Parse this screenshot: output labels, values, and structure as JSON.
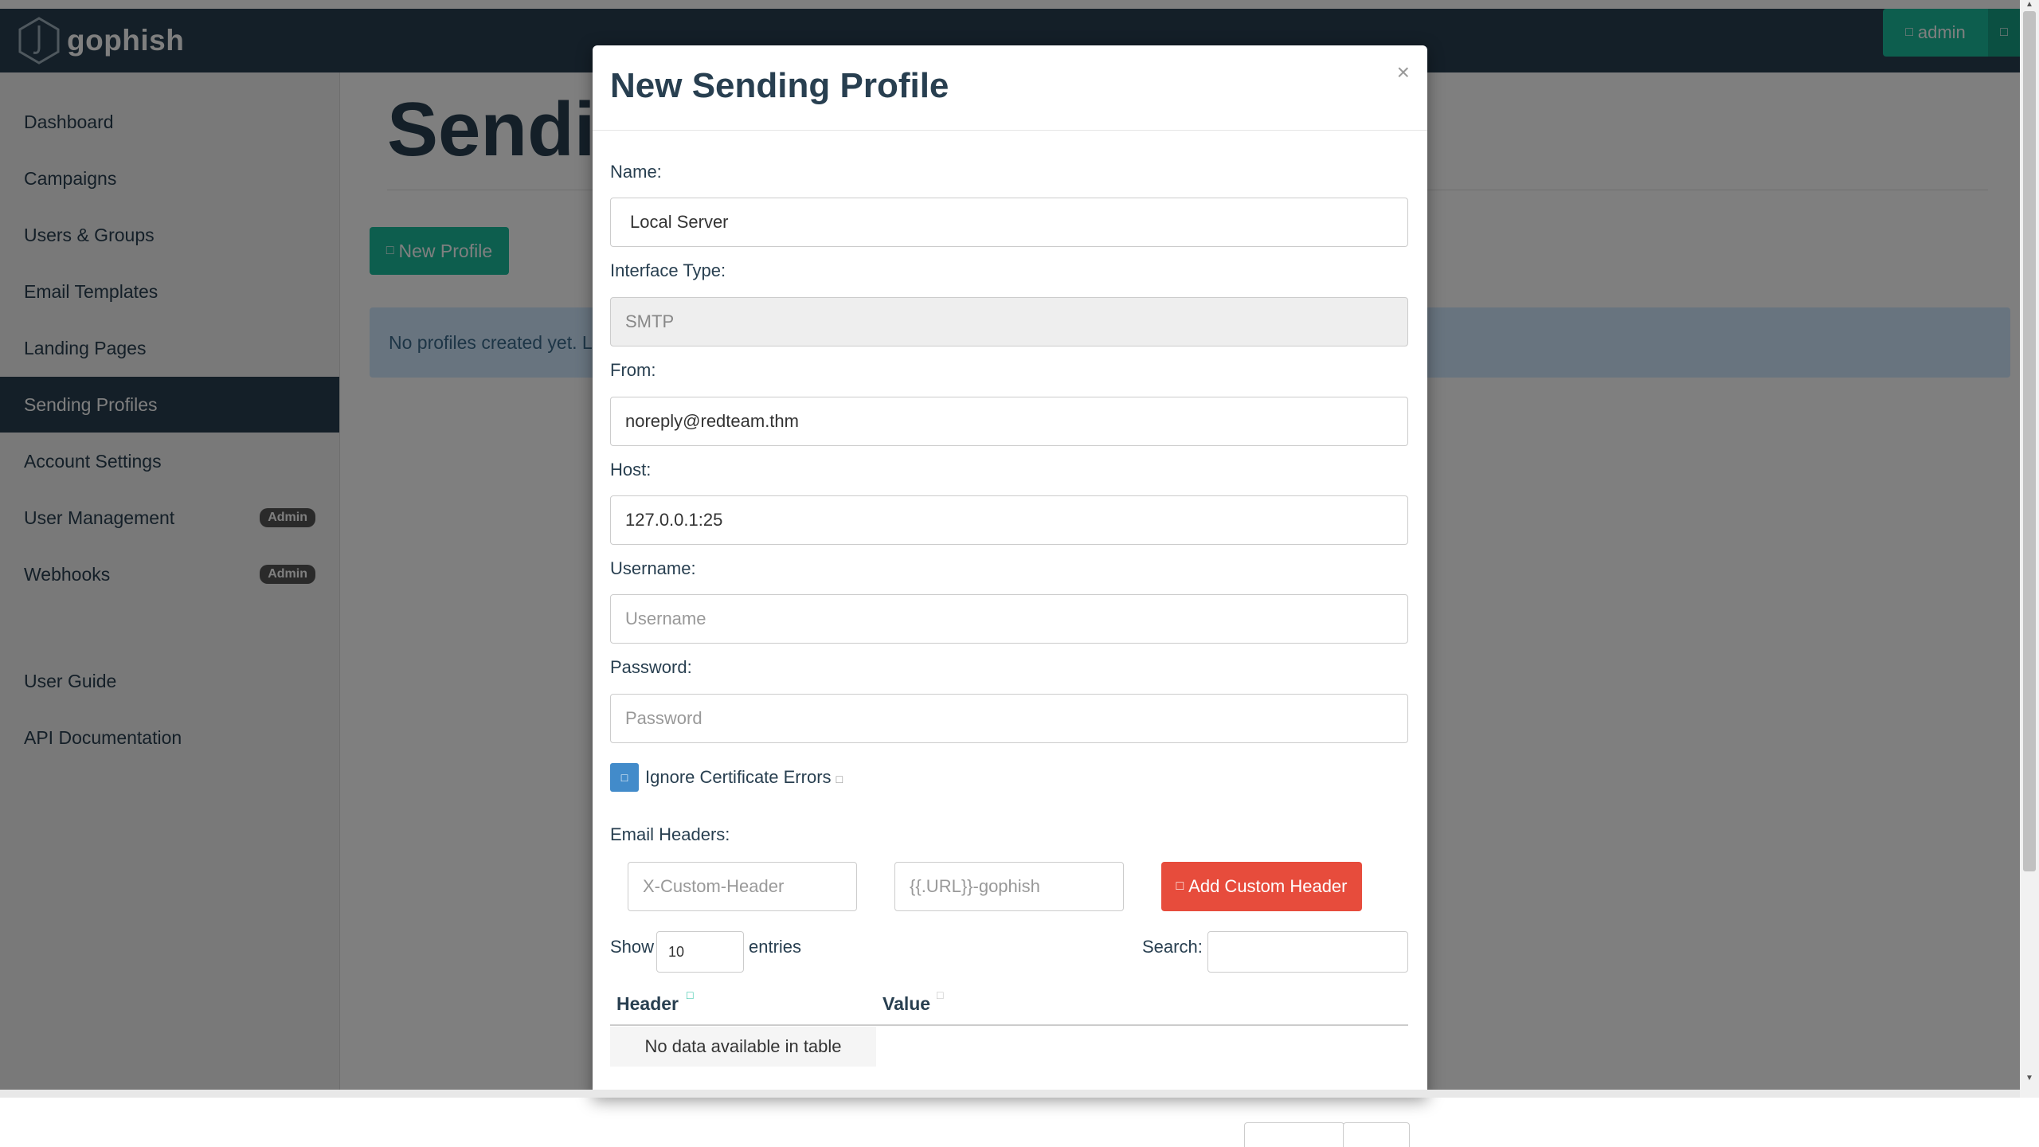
{
  "navbar": {
    "brand": "gophish",
    "admin_label": "admin",
    "dropdown_icon": "caret-icon"
  },
  "sidebar": {
    "items": [
      {
        "label": "Dashboard"
      },
      {
        "label": "Campaigns"
      },
      {
        "label": "Users & Groups"
      },
      {
        "label": "Email Templates"
      },
      {
        "label": "Landing Pages"
      },
      {
        "label": "Sending Profiles",
        "active": true
      },
      {
        "label": "Account Settings"
      },
      {
        "label": "User Management",
        "badge": "Admin"
      },
      {
        "label": "Webhooks",
        "badge": "Admin"
      },
      {
        "label": "User Guide"
      },
      {
        "label": "API Documentation"
      }
    ]
  },
  "main": {
    "page_title": "Sendin",
    "new_profile_label": "New Profile",
    "empty_message": "No profiles created yet. Le"
  },
  "modal": {
    "title": "New Sending Profile",
    "close": "×",
    "name_label": "Name:",
    "name_value": "Local Server",
    "interface_label": "Interface Type:",
    "interface_value": "SMTP",
    "from_label": "From:",
    "from_value": "noreply@redteam.thm",
    "host_label": "Host:",
    "host_value": "127.0.0.1:25",
    "username_label": "Username:",
    "username_placeholder": "Username",
    "password_label": "Password:",
    "password_placeholder": "Password",
    "ignore_cert_label": "Ignore Certificate Errors",
    "email_headers_label": "Email Headers:",
    "header_name_placeholder": "X-Custom-Header",
    "header_value_placeholder": "{{.URL}}-gophish",
    "add_header_label": "Add Custom Header",
    "show_label": "Show",
    "entries_value": "10",
    "entries_label": "entries",
    "search_label": "Search:",
    "table": {
      "columns": [
        "Header",
        "Value"
      ],
      "empty_message": "No data available in table"
    }
  },
  "colors": {
    "navbar": "#283f50",
    "accent": "#1abc9c",
    "danger": "#e74c3c",
    "checkbox": "#428bca"
  }
}
